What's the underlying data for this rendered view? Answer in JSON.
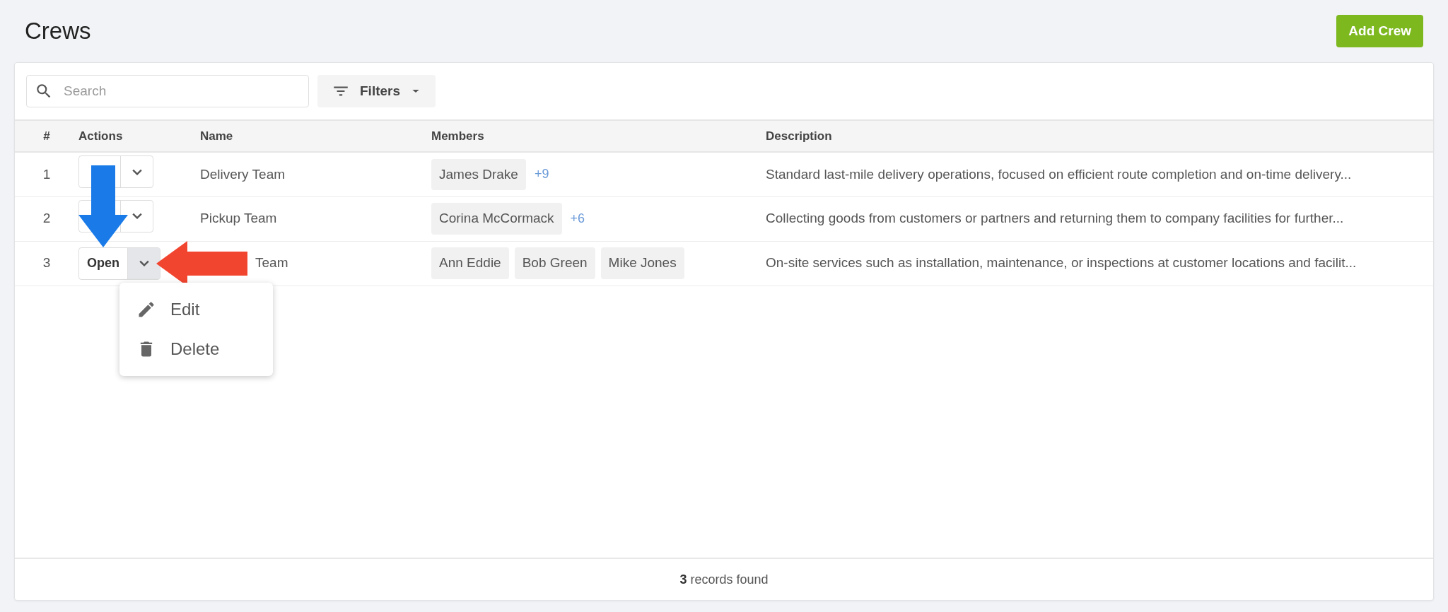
{
  "page": {
    "title": "Crews",
    "add_button": "Add Crew"
  },
  "toolbar": {
    "search": {
      "placeholder": "Search"
    },
    "filters": "Filters"
  },
  "table": {
    "columns": [
      "#",
      "Actions",
      "Name",
      "Members",
      "Description"
    ],
    "rows": [
      {
        "number": "1",
        "expanded": false,
        "name": "Delivery Team",
        "members": [
          "James Drake"
        ],
        "more": "+9",
        "description": "Standard last-mile delivery operations, focused on efficient route completion and on-time delivery..."
      },
      {
        "number": "2",
        "expanded": false,
        "name": "Pickup Team",
        "members": [
          "Corina McCormack"
        ],
        "more": "+6",
        "description": "Collecting goods from customers or partners and returning them to company facilities for further..."
      },
      {
        "number": "3",
        "action": "Open",
        "expanded": true,
        "name": "Team",
        "members": [
          "Ann Eddie",
          "Bob Green",
          "Mike Jones"
        ],
        "description": "On-site services such as installation, maintenance, or inspections at customer locations and facilit...",
        "pointers": [
          {
            "kind": "down",
            "color": "#1a7be8"
          },
          {
            "kind": "left",
            "color": "#f2452f"
          }
        ]
      }
    ]
  },
  "menu": {
    "items": [
      {
        "kind": "edit",
        "label": "Edit"
      },
      {
        "kind": "delete",
        "label": "Delete"
      }
    ]
  },
  "footer": "**3** records found"
}
